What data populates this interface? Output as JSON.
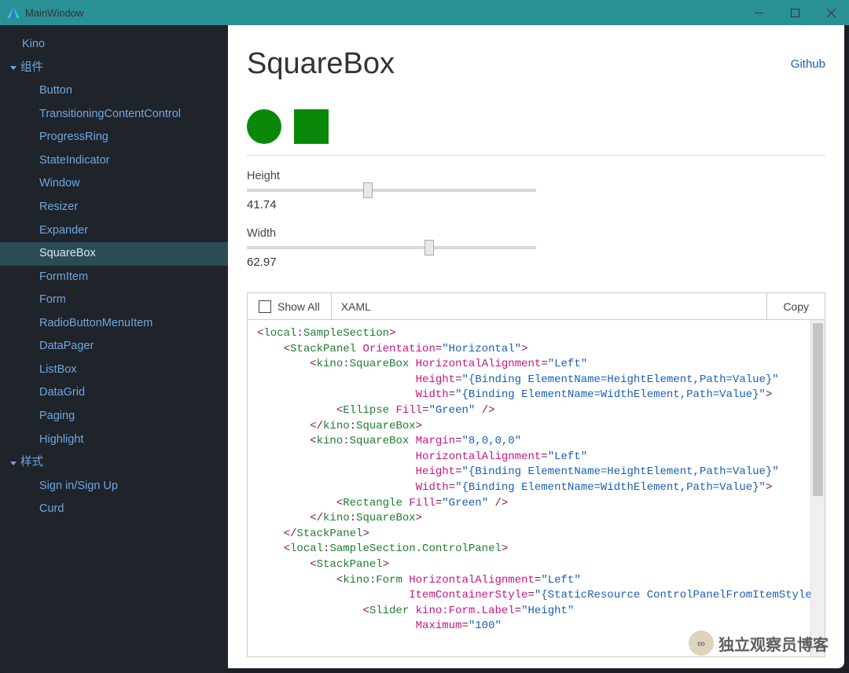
{
  "window": {
    "title": "MainWindow"
  },
  "sidebar": {
    "top": "Kino",
    "groups": [
      {
        "label": "组件",
        "items": [
          "Button",
          "TransitioningContentControl",
          "ProgressRing",
          "StateIndicator",
          "Window",
          "Resizer",
          "Expander",
          "SquareBox",
          "FormItem",
          "Form",
          "RadioButtonMenuItem",
          "DataPager",
          "ListBox",
          "DataGrid",
          "Paging",
          "Highlight"
        ],
        "active": "SquareBox"
      },
      {
        "label": "样式",
        "items": [
          "Sign in/Sign Up",
          "Curd"
        ]
      }
    ]
  },
  "page": {
    "title": "SquareBox",
    "github": "Github"
  },
  "controls": {
    "height": {
      "label": "Height",
      "value": "41.74",
      "max": 100
    },
    "width": {
      "label": "Width",
      "value": "62.97",
      "max": 100
    }
  },
  "codepanel": {
    "showall": "Show All",
    "tab": "XAML",
    "copy": "Copy"
  },
  "code": {
    "lines": [
      [
        [
          "tag",
          "<"
        ],
        [
          "pref",
          "local"
        ],
        [
          "tag",
          ":"
        ],
        [
          "el",
          "SampleSection"
        ],
        [
          "tag",
          ">"
        ]
      ],
      [
        [
          "plain",
          "    "
        ],
        [
          "tag",
          "<"
        ],
        [
          "el",
          "StackPanel"
        ],
        [
          "plain",
          " "
        ],
        [
          "attr",
          "Orientation"
        ],
        [
          "tag",
          "="
        ],
        [
          "val",
          "\"Horizontal\""
        ],
        [
          "tag",
          ">"
        ]
      ],
      [
        [
          "plain",
          "        "
        ],
        [
          "tag",
          "<"
        ],
        [
          "pref",
          "kino"
        ],
        [
          "tag",
          ":"
        ],
        [
          "el",
          "SquareBox"
        ],
        [
          "plain",
          " "
        ],
        [
          "attr",
          "HorizontalAlignment"
        ],
        [
          "tag",
          "="
        ],
        [
          "val",
          "\"Left\""
        ]
      ],
      [
        [
          "plain",
          "                        "
        ],
        [
          "attr",
          "Height"
        ],
        [
          "tag",
          "="
        ],
        [
          "val",
          "\"{Binding ElementName=HeightElement,Path=Value}\""
        ]
      ],
      [
        [
          "plain",
          "                        "
        ],
        [
          "attr",
          "Width"
        ],
        [
          "tag",
          "="
        ],
        [
          "val",
          "\"{Binding ElementName=WidthElement,Path=Value}\""
        ],
        [
          "tag",
          ">"
        ]
      ],
      [
        [
          "plain",
          "            "
        ],
        [
          "tag",
          "<"
        ],
        [
          "el",
          "Ellipse"
        ],
        [
          "plain",
          " "
        ],
        [
          "attr",
          "Fill"
        ],
        [
          "tag",
          "="
        ],
        [
          "val",
          "\"Green\""
        ],
        [
          "plain",
          " "
        ],
        [
          "tag",
          "/>"
        ]
      ],
      [
        [
          "plain",
          "        "
        ],
        [
          "tag",
          "</"
        ],
        [
          "pref",
          "kino"
        ],
        [
          "tag",
          ":"
        ],
        [
          "el",
          "SquareBox"
        ],
        [
          "tag",
          ">"
        ]
      ],
      [
        [
          "plain",
          "        "
        ],
        [
          "tag",
          "<"
        ],
        [
          "pref",
          "kino"
        ],
        [
          "tag",
          ":"
        ],
        [
          "el",
          "SquareBox"
        ],
        [
          "plain",
          " "
        ],
        [
          "attr",
          "Margin"
        ],
        [
          "tag",
          "="
        ],
        [
          "val",
          "\"8,0,0,0\""
        ]
      ],
      [
        [
          "plain",
          "                        "
        ],
        [
          "attr",
          "HorizontalAlignment"
        ],
        [
          "tag",
          "="
        ],
        [
          "val",
          "\"Left\""
        ]
      ],
      [
        [
          "plain",
          "                        "
        ],
        [
          "attr",
          "Height"
        ],
        [
          "tag",
          "="
        ],
        [
          "val",
          "\"{Binding ElementName=HeightElement,Path=Value}\""
        ]
      ],
      [
        [
          "plain",
          "                        "
        ],
        [
          "attr",
          "Width"
        ],
        [
          "tag",
          "="
        ],
        [
          "val",
          "\"{Binding ElementName=WidthElement,Path=Value}\""
        ],
        [
          "tag",
          ">"
        ]
      ],
      [
        [
          "plain",
          "            "
        ],
        [
          "tag",
          "<"
        ],
        [
          "el",
          "Rectangle"
        ],
        [
          "plain",
          " "
        ],
        [
          "attr",
          "Fill"
        ],
        [
          "tag",
          "="
        ],
        [
          "val",
          "\"Green\""
        ],
        [
          "plain",
          " "
        ],
        [
          "tag",
          "/>"
        ]
      ],
      [
        [
          "plain",
          "        "
        ],
        [
          "tag",
          "</"
        ],
        [
          "pref",
          "kino"
        ],
        [
          "tag",
          ":"
        ],
        [
          "el",
          "SquareBox"
        ],
        [
          "tag",
          ">"
        ]
      ],
      [
        [
          "plain",
          "    "
        ],
        [
          "tag",
          "</"
        ],
        [
          "el",
          "StackPanel"
        ],
        [
          "tag",
          ">"
        ]
      ],
      [
        [
          "plain",
          "    "
        ],
        [
          "tag",
          "<"
        ],
        [
          "pref",
          "local"
        ],
        [
          "tag",
          ":"
        ],
        [
          "el",
          "SampleSection.ControlPanel"
        ],
        [
          "tag",
          ">"
        ]
      ],
      [
        [
          "plain",
          "        "
        ],
        [
          "tag",
          "<"
        ],
        [
          "el",
          "StackPanel"
        ],
        [
          "tag",
          ">"
        ]
      ],
      [
        [
          "plain",
          "            "
        ],
        [
          "tag",
          "<"
        ],
        [
          "pref",
          "kino"
        ],
        [
          "tag",
          ":"
        ],
        [
          "el",
          "Form"
        ],
        [
          "plain",
          " "
        ],
        [
          "attr",
          "HorizontalAlignment"
        ],
        [
          "tag",
          "="
        ],
        [
          "val",
          "\"Left\""
        ]
      ],
      [
        [
          "plain",
          "                       "
        ],
        [
          "attr",
          "ItemContainerStyle"
        ],
        [
          "tag",
          "="
        ],
        [
          "val",
          "\"{StaticResource ControlPanelFromItemStyle}\""
        ],
        [
          "tag",
          ">"
        ]
      ],
      [
        [
          "plain",
          "                "
        ],
        [
          "tag",
          "<"
        ],
        [
          "el",
          "Slider"
        ],
        [
          "plain",
          " "
        ],
        [
          "attr",
          "kino:Form.Label"
        ],
        [
          "tag",
          "="
        ],
        [
          "val",
          "\"Height\""
        ]
      ],
      [
        [
          "plain",
          "                        "
        ],
        [
          "attr",
          "Maximum"
        ],
        [
          "tag",
          "="
        ],
        [
          "val",
          "\"100\""
        ]
      ]
    ]
  },
  "watermark": {
    "text": "独立观察员博客",
    "avatar": "∞"
  }
}
